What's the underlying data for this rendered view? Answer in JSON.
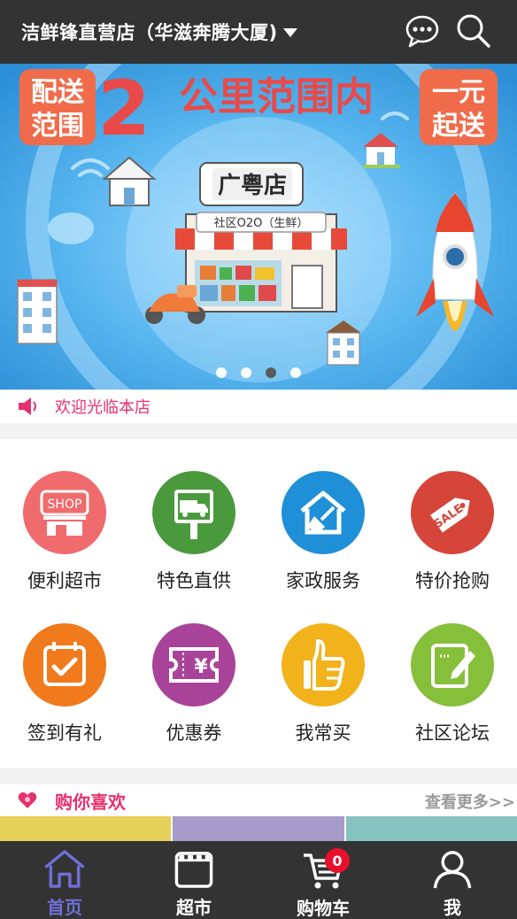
{
  "header": {
    "store_name": "洁鲜锋直营店（华滋奔腾大厦)",
    "icons": [
      "chat-icon",
      "search-icon"
    ]
  },
  "banner": {
    "left_tag": [
      "配送",
      "范围"
    ],
    "headline_number": "2",
    "headline_text": "公里范围内",
    "right_tag": [
      "一元",
      "起送"
    ],
    "shop_sign": "广粤店",
    "shop_subsign": "社区O2O（生鲜）",
    "slide_count": 4,
    "active_slide": 3,
    "colors": {
      "sky": "#3fa5e8",
      "tag": "#f06b4a",
      "headline": "#e84a4a"
    }
  },
  "notice": {
    "text": "欢迎光临本店",
    "icon": "speaker-icon",
    "color": "#e8306e"
  },
  "categories": [
    {
      "label": "便利超市",
      "icon": "shop-icon",
      "color": "#ef6b6e"
    },
    {
      "label": "特色直供",
      "icon": "truck-sign-icon",
      "color": "#4a9a3d"
    },
    {
      "label": "家政服务",
      "icon": "house-broom-icon",
      "color": "#1f8fd8"
    },
    {
      "label": "特价抢购",
      "icon": "sale-tag-icon",
      "color": "#d6453a"
    },
    {
      "label": "签到有礼",
      "icon": "calendar-check-icon",
      "color": "#f07a1c"
    },
    {
      "label": "优惠券",
      "icon": "coupon-icon",
      "color": "#a9439a"
    },
    {
      "label": "我常买",
      "icon": "thumbs-up-icon",
      "color": "#f2b21b"
    },
    {
      "label": "社区论坛",
      "icon": "note-pen-icon",
      "color": "#86bf3a"
    }
  ],
  "recommend": {
    "title": "购你喜欢",
    "more": "查看更多>>",
    "icon": "heart-icon",
    "thumb_colors": [
      "#e6d25a",
      "#a79bc9",
      "#86c2c0"
    ]
  },
  "tabbar": {
    "tabs": [
      {
        "label": "首页",
        "icon": "home-icon",
        "active": true
      },
      {
        "label": "超市",
        "icon": "store-icon",
        "active": false
      },
      {
        "label": "购物车",
        "icon": "cart-icon",
        "active": false,
        "badge": "0"
      },
      {
        "label": "我",
        "icon": "user-icon",
        "active": false
      }
    ],
    "active_color": "#6f6fd6"
  }
}
